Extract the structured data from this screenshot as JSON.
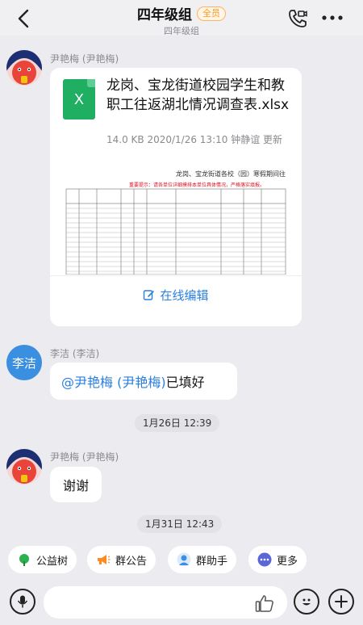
{
  "header": {
    "title": "四年级组",
    "badge": "全员",
    "subtitle": "四年级组"
  },
  "messages": {
    "m1": {
      "sender": "尹艳梅 (尹艳梅)",
      "file_type_letter": "X",
      "file_name": "龙岗、宝龙街道校园学生和教职工往返湖北情况调查表.xlsx",
      "file_meta": "14.0 KB  2020/1/26 13:10  钟静谊 更新",
      "preview_title": "龙岗、宝龙街道各校（园）寒假期间往",
      "preview_note": "重要提示：请各单位详细摸排本单位具体情况，严格落实填报。",
      "edit_label": "在线编辑"
    },
    "m2": {
      "sender": "李洁 (李洁)",
      "avatar_text": "李洁",
      "mention": "@尹艳梅 (尹艳梅)",
      "text": " 已填好"
    },
    "time1": "1月26日 12:39",
    "m3": {
      "sender": "尹艳梅 (尹艳梅)",
      "text": "谢谢"
    },
    "time2": "1月31日 12:43"
  },
  "quick_actions": [
    {
      "label": "公益树",
      "icon": "tree-icon",
      "color": "#2bb24c"
    },
    {
      "label": "群公告",
      "icon": "megaphone-icon",
      "color": "#ff8a1f"
    },
    {
      "label": "群助手",
      "icon": "assistant-icon",
      "color": "#3a8fe0"
    },
    {
      "label": "更多",
      "icon": "more-dots-icon",
      "color": "#5a67d8"
    }
  ],
  "colors": {
    "accent": "#2a7fe0",
    "badge": "#ff9a1f",
    "background": "#ececf0"
  }
}
